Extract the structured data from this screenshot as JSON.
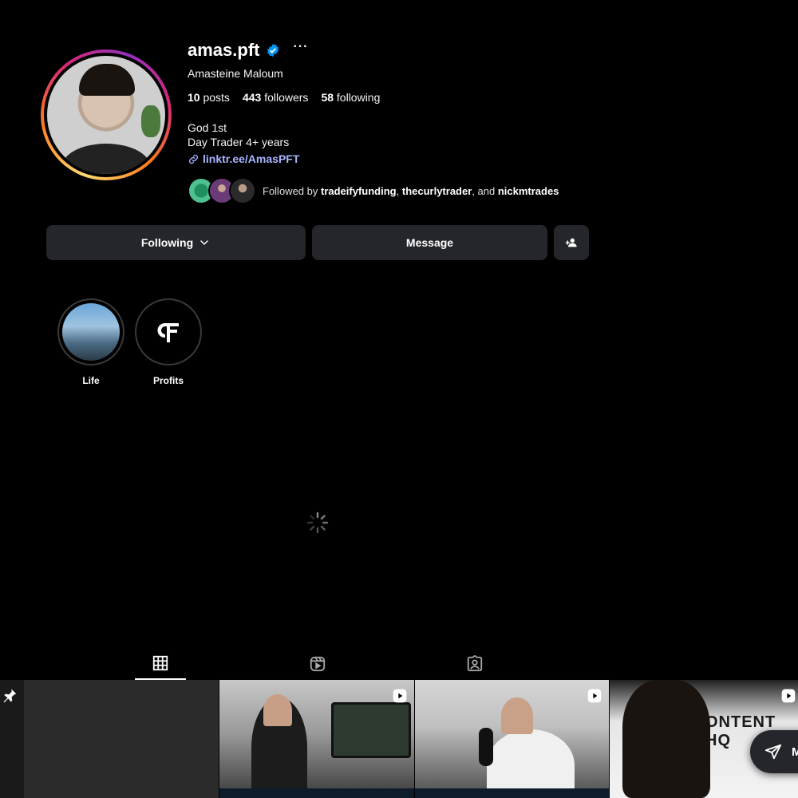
{
  "profile": {
    "username": "amas.pft",
    "more_label": "···",
    "full_name": "Amasteine Maloum",
    "stats": {
      "posts_count": "10",
      "posts_label": "posts",
      "followers_count": "443",
      "followers_label": "followers",
      "following_count": "58",
      "following_label": "following"
    },
    "bio": [
      "God 1st",
      "Day Trader 4+ years"
    ],
    "link": "linktr.ee/AmasPFT",
    "followed_by": {
      "prefix": "Followed by",
      "names": [
        "tradeifyfunding",
        "thecurlytrader",
        "nickmtrades"
      ],
      "sep": ",",
      "and": ", and"
    }
  },
  "actions": {
    "following_label": "Following",
    "message_label": "Message"
  },
  "highlights": [
    {
      "label": "Life"
    },
    {
      "label": "Profits"
    }
  ],
  "tabs": {
    "posts_icon": "grid-icon",
    "reels_icon": "reels-icon",
    "tagged_icon": "tagged-icon"
  },
  "grid": {
    "tile4_text": "ONTENT HQ"
  },
  "messages_pill": {
    "label": "M"
  },
  "colors": {
    "background": "#000000",
    "button_bg": "#25262b",
    "link": "#a8b4ff",
    "verified": "#0095f6"
  }
}
